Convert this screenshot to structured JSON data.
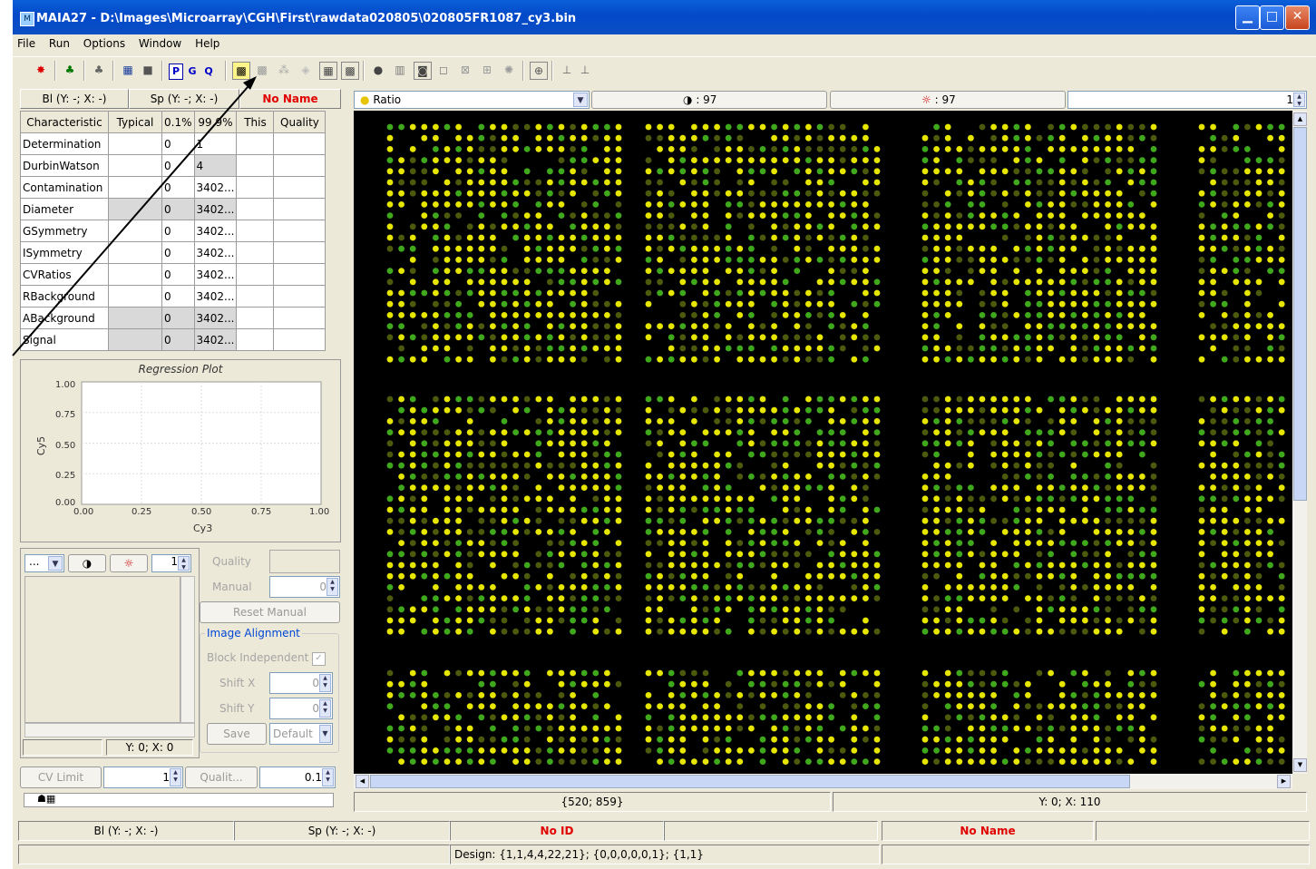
{
  "window": {
    "title": "MAIA27 - D:\\Images\\Microarray\\CGH\\First\\rawdata020805\\020805FR1087_cy3.bin",
    "icon": "app-icon",
    "buttons": [
      "minimize-icon",
      "maximize-icon",
      "close-icon"
    ]
  },
  "menu": [
    "File",
    "Run",
    "Options",
    "Window",
    "Help"
  ],
  "toolbar": {
    "pgq": [
      "P",
      "G",
      "Q"
    ]
  },
  "left_header": {
    "bl": "Bl (Y: -; X: -)",
    "sp": "Sp (Y: -; X: -)",
    "name": "No Name"
  },
  "table": {
    "columns": [
      "Characteristic",
      "Typical",
      "0.1%",
      "99.9%",
      "This",
      "Quality"
    ],
    "rows": [
      {
        "name": "Determination",
        "typical": "",
        "low": "0",
        "high": "1",
        "this": "",
        "quality": ""
      },
      {
        "name": "DurbinWatson",
        "typical": "",
        "low": "0",
        "high": "4",
        "this": "",
        "quality": ""
      },
      {
        "name": "Contamination",
        "typical": "",
        "low": "0",
        "high": "3402...",
        "this": "",
        "quality": ""
      },
      {
        "name": "Diameter",
        "typical": "",
        "low": "0",
        "high": "3402...",
        "this": "",
        "quality": ""
      },
      {
        "name": "GSymmetry",
        "typical": "",
        "low": "0",
        "high": "3402...",
        "this": "",
        "quality": ""
      },
      {
        "name": "ISymmetry",
        "typical": "",
        "low": "0",
        "high": "3402...",
        "this": "",
        "quality": ""
      },
      {
        "name": "CVRatios",
        "typical": "",
        "low": "0",
        "high": "3402...",
        "this": "",
        "quality": ""
      },
      {
        "name": "RBackground",
        "typical": "",
        "low": "0",
        "high": "3402...",
        "this": "",
        "quality": ""
      },
      {
        "name": "ABackground",
        "typical": "",
        "low": "0",
        "high": "3402...",
        "this": "",
        "quality": ""
      },
      {
        "name": "Signal",
        "typical": "",
        "low": "0",
        "high": "3402...",
        "this": "",
        "quality": ""
      }
    ]
  },
  "regression_plot": {
    "title": "Regression Plot",
    "xlabel": "Cy3",
    "ylabel": "Cy5",
    "yticks": [
      "1.00",
      "0.75",
      "0.50",
      "0.25",
      "0.00"
    ],
    "xticks": [
      "0.00",
      "0.25",
      "0.50",
      "0.75",
      "1.00"
    ]
  },
  "spot_panel": {
    "combo": "...",
    "spinner_value": "1",
    "coords": "Y: 0; X: 0",
    "quality_label": "Quality",
    "manual_label": "Manual",
    "manual_value": "0",
    "reset_manual": "Reset Manual",
    "alignment_title": "Image Alignment",
    "block_independent": "Block Independent",
    "shift_x_label": "Shift X",
    "shift_x_value": "0",
    "shift_y_label": "Shift Y",
    "shift_y_value": "0",
    "save": "Save",
    "default": "Default"
  },
  "filter": {
    "cv_limit": "CV Limit",
    "cv_value": "1",
    "quality": "Qualit...",
    "quality_value": "0.1"
  },
  "image_header": {
    "mode": "Ratio",
    "dark_count": ": 97",
    "light_count": ": 97",
    "spinner_value": "1"
  },
  "image_status": {
    "position": "{520; 859}",
    "coords": "Y: 0; X: 110"
  },
  "statusbar": {
    "bl": "Bl (Y: -; X: -)",
    "sp": "Sp (Y: -; X: -)",
    "id": "No ID",
    "name": "No Name",
    "design": "Design: {1,1,4,4,22,21}; {0,0,0,0,0,1}; {1,1}"
  },
  "colors": {
    "title_bar": "#0349c9",
    "red_text": "#e00000",
    "spot_yellow": "#e6e600",
    "spot_green": "#3fa81c",
    "spot_dim": "#4c5a0e"
  }
}
